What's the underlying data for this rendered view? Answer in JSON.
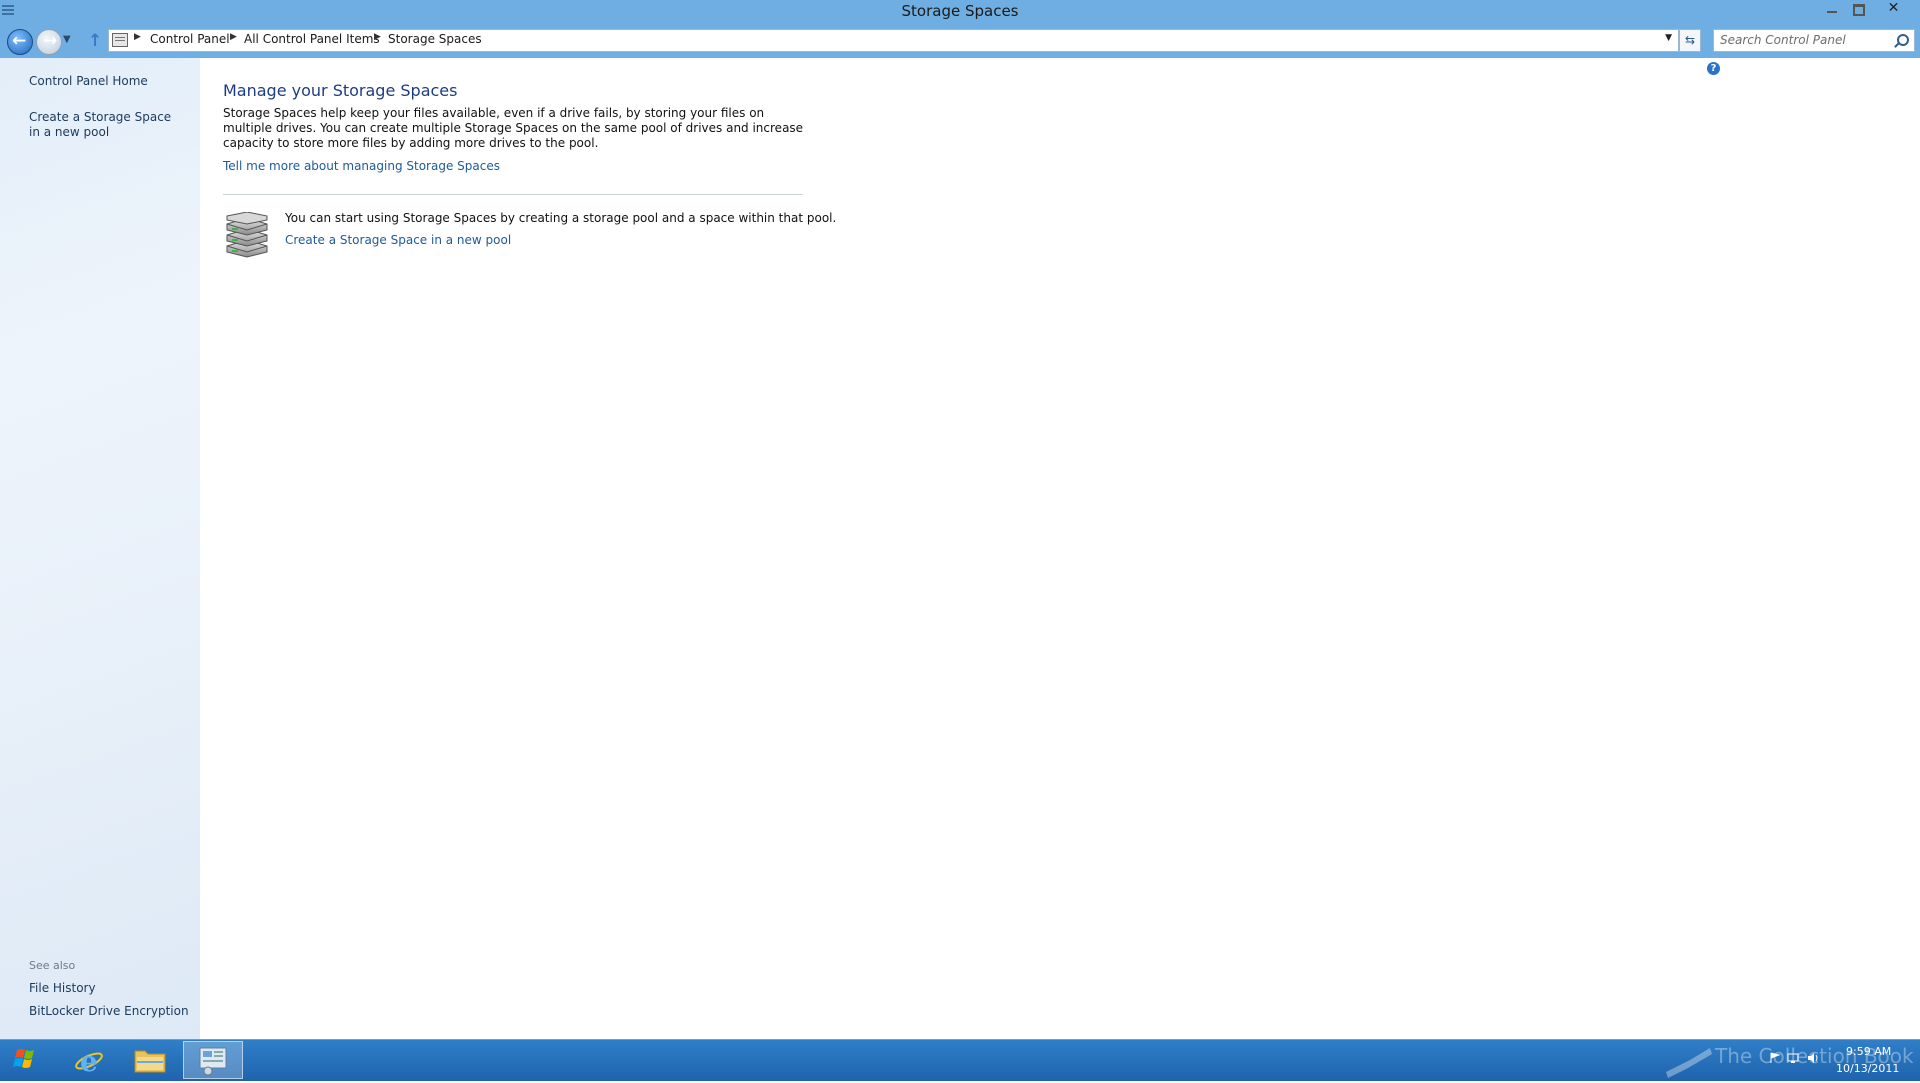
{
  "window": {
    "title": "Storage Spaces"
  },
  "nav": {
    "breadcrumbs": [
      "Control Panel",
      "All Control Panel Items",
      "Storage Spaces"
    ],
    "search_placeholder": "Search Control Panel"
  },
  "sidebar": {
    "home": "Control Panel Home",
    "create": "Create a Storage Space in a new pool",
    "see_also_heading": "See also",
    "see_also": [
      "File History",
      "BitLocker Drive Encryption"
    ]
  },
  "main": {
    "title": "Manage your Storage Spaces",
    "intro": "Storage Spaces help keep your files available, even if a drive fails, by storing your files on multiple drives.  You can create multiple Storage Spaces on the same pool of drives and increase capacity to store more files by adding more drives to the pool.",
    "learn_more": "Tell me more about managing Storage Spaces",
    "start_text": "You can start using Storage Spaces by creating a storage pool and a space within that pool.",
    "create_link": "Create a Storage Space in a new pool"
  },
  "taskbar": {
    "watermark": "The Collection Book",
    "time": "9:59 AM",
    "date": "10/13/2011"
  },
  "colors": {
    "title_bar": "#6eaee3",
    "link": "#1f5a98",
    "heading": "#1e3c86",
    "taskbar": "#1f63ad"
  },
  "icons": {
    "storage_pool": "storage-pool-icon",
    "back": "back-arrow-icon",
    "forward": "forward-arrow-icon",
    "up": "up-arrow-icon",
    "search": "search-icon",
    "help": "help-icon"
  }
}
